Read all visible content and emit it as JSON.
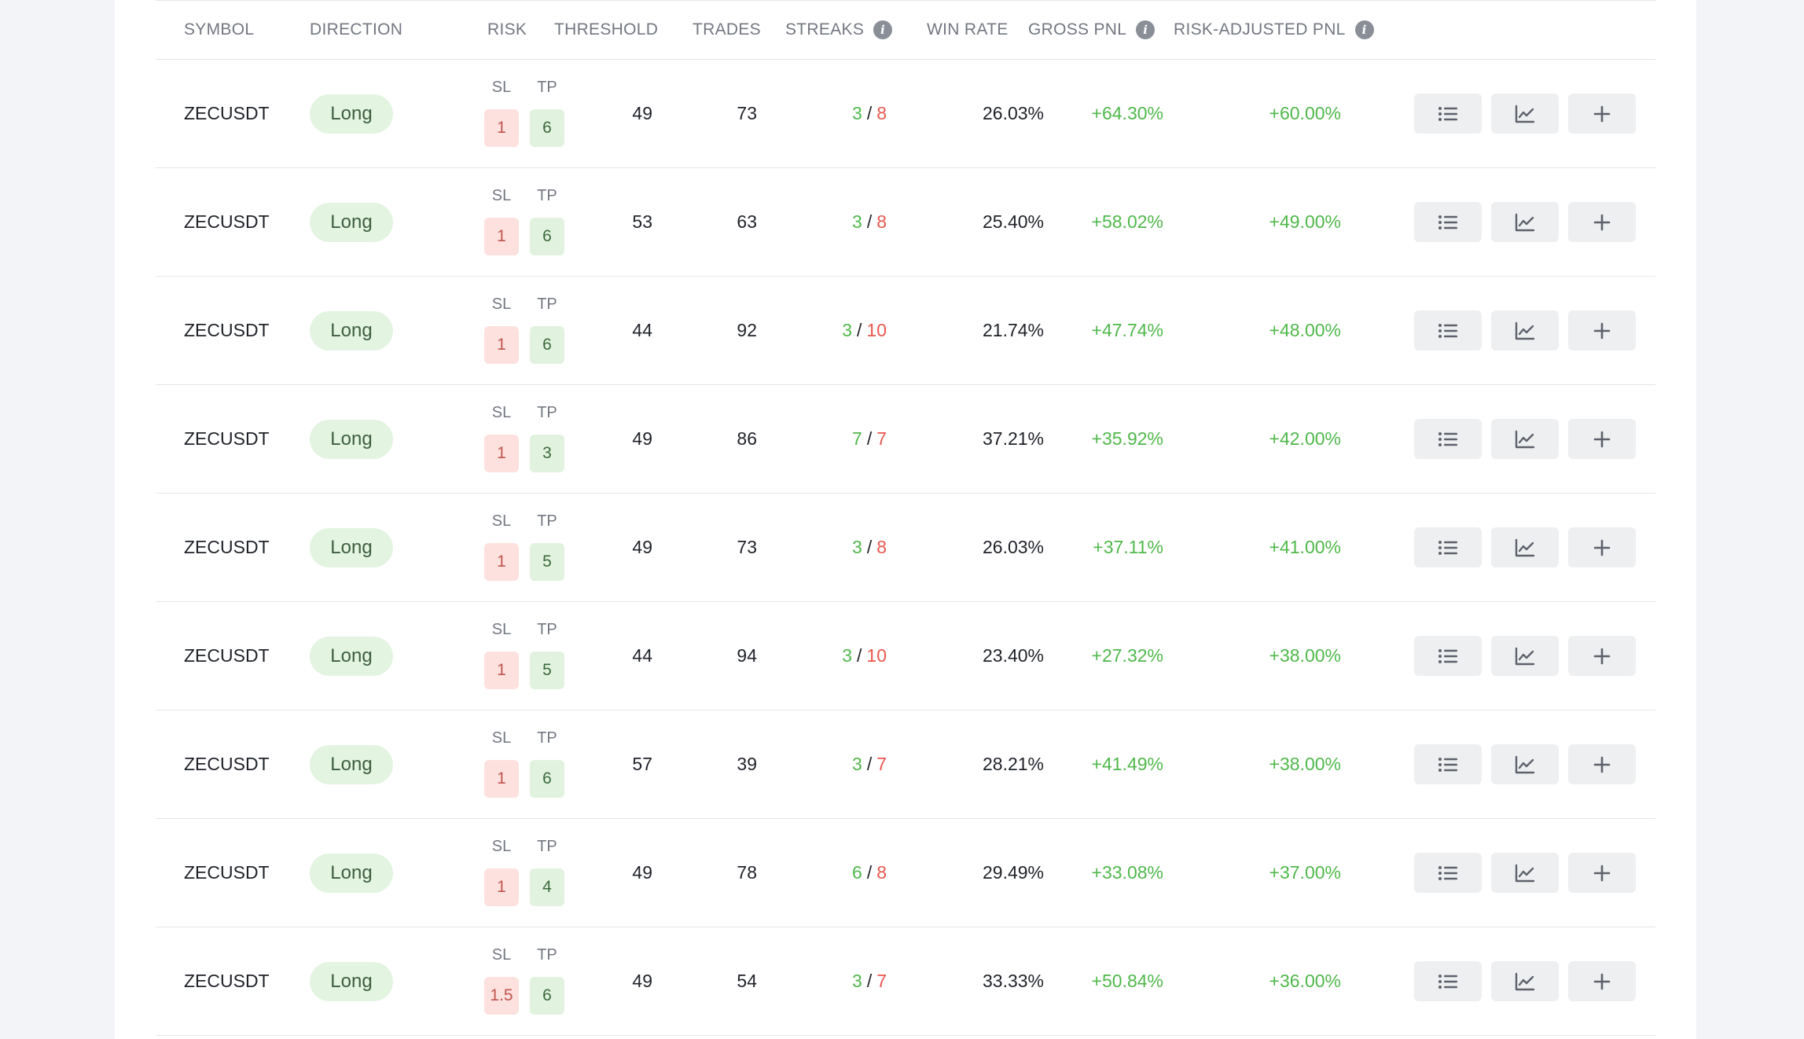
{
  "table": {
    "headers": {
      "symbol": "SYMBOL",
      "direction": "DIRECTION",
      "risk": "RISK",
      "threshold": "THRESHOLD",
      "trades": "TRADES",
      "streaks": "STREAKS",
      "win_rate": "WIN RATE",
      "gross_pnl": "GROSS PNL",
      "risk_adjusted_pnl": "RISK-ADJUSTED PNL"
    },
    "risk_labels": {
      "sl": "SL",
      "tp": "TP"
    },
    "info_glyph": "i",
    "rows": [
      {
        "symbol": "ZECUSDT",
        "direction": "Long",
        "sl": "1",
        "tp": "6",
        "threshold": "49",
        "trades": "73",
        "streak_win": "3",
        "streak_sep": "/",
        "streak_loss": "8",
        "win_rate": "26.03%",
        "gross_pnl": "+64.30%",
        "risk_adjusted_pnl": "+60.00%"
      },
      {
        "symbol": "ZECUSDT",
        "direction": "Long",
        "sl": "1",
        "tp": "6",
        "threshold": "53",
        "trades": "63",
        "streak_win": "3",
        "streak_sep": "/",
        "streak_loss": "8",
        "win_rate": "25.40%",
        "gross_pnl": "+58.02%",
        "risk_adjusted_pnl": "+49.00%"
      },
      {
        "symbol": "ZECUSDT",
        "direction": "Long",
        "sl": "1",
        "tp": "6",
        "threshold": "44",
        "trades": "92",
        "streak_win": "3",
        "streak_sep": "/",
        "streak_loss": "10",
        "win_rate": "21.74%",
        "gross_pnl": "+47.74%",
        "risk_adjusted_pnl": "+48.00%"
      },
      {
        "symbol": "ZECUSDT",
        "direction": "Long",
        "sl": "1",
        "tp": "3",
        "threshold": "49",
        "trades": "86",
        "streak_win": "7",
        "streak_sep": "/",
        "streak_loss": "7",
        "win_rate": "37.21%",
        "gross_pnl": "+35.92%",
        "risk_adjusted_pnl": "+42.00%"
      },
      {
        "symbol": "ZECUSDT",
        "direction": "Long",
        "sl": "1",
        "tp": "5",
        "threshold": "49",
        "trades": "73",
        "streak_win": "3",
        "streak_sep": "/",
        "streak_loss": "8",
        "win_rate": "26.03%",
        "gross_pnl": "+37.11%",
        "risk_adjusted_pnl": "+41.00%"
      },
      {
        "symbol": "ZECUSDT",
        "direction": "Long",
        "sl": "1",
        "tp": "5",
        "threshold": "44",
        "trades": "94",
        "streak_win": "3",
        "streak_sep": "/",
        "streak_loss": "10",
        "win_rate": "23.40%",
        "gross_pnl": "+27.32%",
        "risk_adjusted_pnl": "+38.00%"
      },
      {
        "symbol": "ZECUSDT",
        "direction": "Long",
        "sl": "1",
        "tp": "6",
        "threshold": "57",
        "trades": "39",
        "streak_win": "3",
        "streak_sep": "/",
        "streak_loss": "7",
        "win_rate": "28.21%",
        "gross_pnl": "+41.49%",
        "risk_adjusted_pnl": "+38.00%"
      },
      {
        "symbol": "ZECUSDT",
        "direction": "Long",
        "sl": "1",
        "tp": "4",
        "threshold": "49",
        "trades": "78",
        "streak_win": "6",
        "streak_sep": "/",
        "streak_loss": "8",
        "win_rate": "29.49%",
        "gross_pnl": "+33.08%",
        "risk_adjusted_pnl": "+37.00%"
      },
      {
        "symbol": "ZECUSDT",
        "direction": "Long",
        "sl": "1.5",
        "tp": "6",
        "threshold": "49",
        "trades": "54",
        "streak_win": "3",
        "streak_sep": "/",
        "streak_loss": "7",
        "win_rate": "33.33%",
        "gross_pnl": "+50.84%",
        "risk_adjusted_pnl": "+36.00%"
      }
    ],
    "row_actions": [
      "list-icon",
      "chart-line-icon",
      "plus-icon"
    ]
  },
  "colors": {
    "positive": "#4fb84a",
    "negative": "#e8574f",
    "long_pill_bg": "#e3f4e1",
    "sl_bg": "#fde1df",
    "tp_bg": "#e1f3df",
    "action_button_bg": "#eeeff1"
  }
}
